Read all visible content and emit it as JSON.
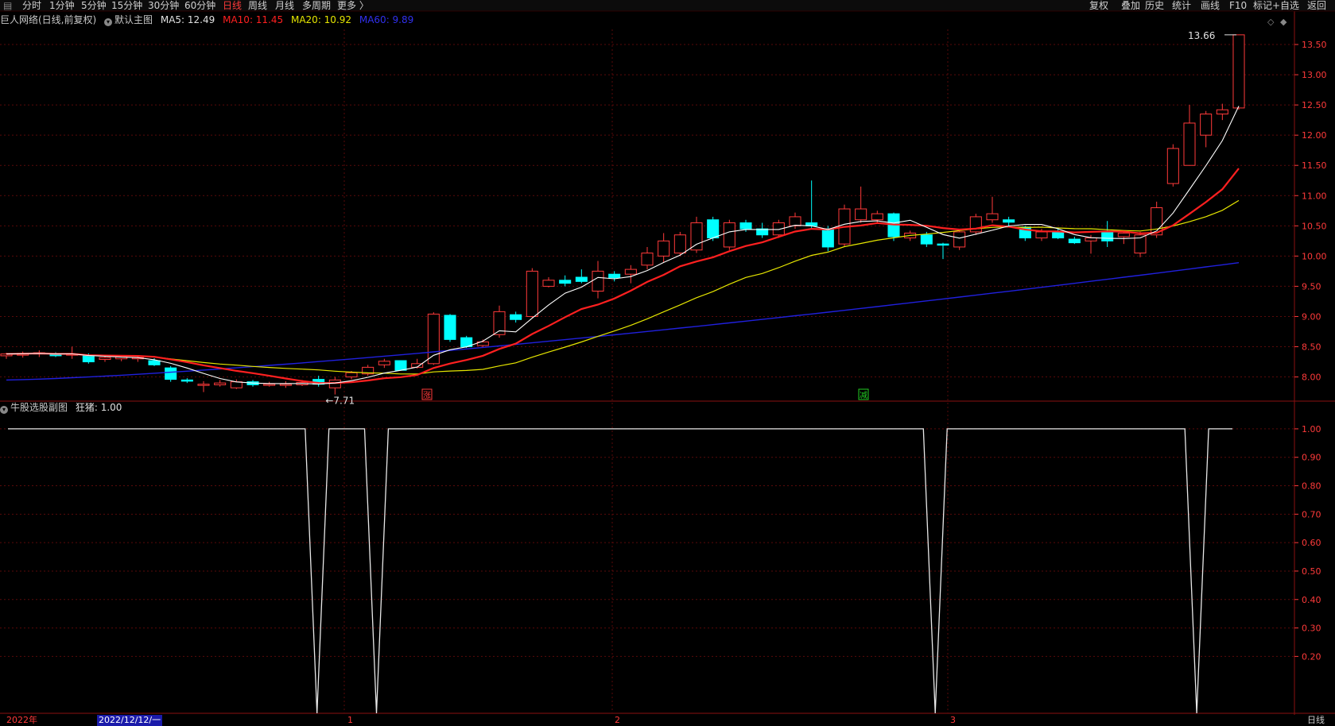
{
  "toolbar": {
    "left_items": [
      {
        "label": "分时",
        "active": false
      },
      {
        "label": "1分钟",
        "active": false
      },
      {
        "label": "5分钟",
        "active": false
      },
      {
        "label": "15分钟",
        "active": false
      },
      {
        "label": "30分钟",
        "active": false
      },
      {
        "label": "60分钟",
        "active": false
      },
      {
        "label": "日线",
        "active": true
      },
      {
        "label": "周线",
        "active": false
      },
      {
        "label": "月线",
        "active": false
      },
      {
        "label": "多周期",
        "active": false
      },
      {
        "label": "更多 〉",
        "active": false
      }
    ],
    "right_items": [
      "复权",
      "叠加",
      "历史",
      "统计",
      "画线",
      "F10",
      "标记",
      "+自选",
      "返回"
    ]
  },
  "main_header": {
    "stock": "巨人网络(日线,前复权)",
    "indicator": "默认主图",
    "ma5": "MA5: 12.49",
    "ma10": "MA10: 11.45",
    "ma20": "MA20: 10.92",
    "ma60": "MA60: 9.89"
  },
  "sub_header": {
    "indicator": "牛股选股副图",
    "value": "狂猪: 1.00"
  },
  "annotations": {
    "high": "13.66",
    "low": "←7.71",
    "rise_mark": "涨",
    "fall_mark": "减"
  },
  "statusbar": {
    "year": "2022年",
    "cursor_date": "2022/12/12/一",
    "months": [
      "1",
      "2",
      "3"
    ],
    "period": "日线"
  },
  "colors": {
    "background": "#000000",
    "grid": "#5a0a0a",
    "up": "#ff3a3a",
    "down": "#00ffff",
    "ma5": "#ffffff",
    "ma10": "#ff2020",
    "ma20": "#e6e600",
    "ma60": "#2020dd",
    "axis_text": "#ff3a3a"
  },
  "chart_data": [
    {
      "type": "candlestick",
      "title": "巨人网络(日线,前复权)",
      "ylim": [
        7.6,
        13.75
      ],
      "y_ticks": [
        "13.50",
        "13.00",
        "12.50",
        "12.00",
        "11.50",
        "11.00",
        "10.50",
        "10.00",
        "9.50",
        "9.00",
        "8.50",
        "8.00"
      ],
      "ohlc": [
        [
          8.35,
          8.4,
          8.3,
          8.38
        ],
        [
          8.36,
          8.42,
          8.32,
          8.39
        ],
        [
          8.38,
          8.44,
          8.33,
          8.4
        ],
        [
          8.37,
          8.41,
          8.33,
          8.36
        ],
        [
          8.36,
          8.5,
          8.3,
          8.38
        ],
        [
          8.35,
          8.39,
          8.22,
          8.25
        ],
        [
          8.29,
          8.34,
          8.25,
          8.32
        ],
        [
          8.3,
          8.36,
          8.26,
          8.33
        ],
        [
          8.3,
          8.36,
          8.25,
          8.32
        ],
        [
          8.27,
          8.31,
          8.18,
          8.2
        ],
        [
          8.15,
          8.18,
          7.92,
          7.96
        ],
        [
          7.95,
          7.98,
          7.9,
          7.93
        ],
        [
          7.88,
          7.93,
          7.75,
          7.88
        ],
        [
          7.87,
          7.95,
          7.84,
          7.9
        ],
        [
          7.82,
          7.96,
          7.8,
          7.92
        ],
        [
          7.92,
          7.95,
          7.84,
          7.87
        ],
        [
          7.88,
          7.92,
          7.84,
          7.88
        ],
        [
          7.86,
          7.93,
          7.82,
          7.88
        ],
        [
          7.87,
          7.95,
          7.85,
          7.91
        ],
        [
          7.96,
          8.02,
          7.84,
          7.88
        ],
        [
          7.82,
          8.0,
          7.71,
          7.95
        ],
        [
          8.0,
          8.1,
          7.96,
          8.07
        ],
        [
          8.05,
          8.2,
          8.02,
          8.16
        ],
        [
          8.2,
          8.3,
          8.15,
          8.26
        ],
        [
          8.27,
          8.19,
          8.12,
          8.11
        ],
        [
          8.16,
          8.3,
          8.14,
          8.22
        ],
        [
          8.22,
          9.07,
          8.2,
          9.04
        ],
        [
          9.02,
          9.04,
          8.58,
          8.62
        ],
        [
          8.65,
          8.68,
          8.48,
          8.5
        ],
        [
          8.52,
          8.62,
          8.48,
          8.58
        ],
        [
          8.7,
          9.18,
          8.65,
          9.08
        ],
        [
          9.03,
          9.08,
          8.9,
          8.95
        ],
        [
          9.0,
          9.8,
          8.98,
          9.75
        ],
        [
          9.5,
          9.65,
          9.48,
          9.6
        ],
        [
          9.6,
          9.68,
          9.5,
          9.55
        ],
        [
          9.65,
          9.78,
          9.55,
          9.58
        ],
        [
          9.42,
          9.92,
          9.3,
          9.75
        ],
        [
          9.7,
          9.75,
          9.58,
          9.64
        ],
        [
          9.7,
          9.85,
          9.55,
          9.78
        ],
        [
          9.85,
          10.15,
          9.78,
          10.05
        ],
        [
          10.0,
          10.38,
          9.9,
          10.25
        ],
        [
          10.05,
          10.4,
          10.0,
          10.35
        ],
        [
          10.1,
          10.65,
          10.05,
          10.55
        ],
        [
          10.6,
          10.65,
          10.25,
          10.3
        ],
        [
          10.15,
          10.6,
          10.1,
          10.55
        ],
        [
          10.55,
          10.6,
          10.4,
          10.45
        ],
        [
          10.45,
          10.55,
          10.3,
          10.35
        ],
        [
          10.35,
          10.6,
          10.3,
          10.55
        ],
        [
          10.5,
          10.72,
          10.45,
          10.65
        ],
        [
          10.55,
          11.25,
          10.45,
          10.5
        ],
        [
          10.45,
          10.5,
          10.08,
          10.15
        ],
        [
          10.2,
          10.85,
          10.15,
          10.78
        ],
        [
          10.6,
          11.15,
          10.55,
          10.78
        ],
        [
          10.6,
          10.75,
          10.55,
          10.7
        ],
        [
          10.7,
          10.72,
          10.25,
          10.32
        ],
        [
          10.3,
          10.42,
          10.25,
          10.38
        ],
        [
          10.35,
          10.4,
          10.15,
          10.2
        ],
        [
          10.2,
          10.22,
          9.95,
          10.18
        ],
        [
          10.15,
          10.45,
          10.1,
          10.4
        ],
        [
          10.4,
          10.7,
          10.35,
          10.65
        ],
        [
          10.6,
          10.98,
          10.55,
          10.7
        ],
        [
          10.6,
          10.65,
          10.48,
          10.56
        ],
        [
          10.48,
          10.5,
          10.25,
          10.3
        ],
        [
          10.3,
          10.45,
          10.25,
          10.4
        ],
        [
          10.4,
          10.45,
          10.28,
          10.3
        ],
        [
          10.28,
          10.32,
          10.2,
          10.22
        ],
        [
          10.25,
          10.35,
          10.04,
          10.3
        ],
        [
          10.4,
          10.58,
          10.15,
          10.25
        ],
        [
          10.32,
          10.42,
          10.2,
          10.38
        ],
        [
          10.05,
          10.4,
          9.98,
          10.35
        ],
        [
          10.35,
          10.9,
          10.3,
          10.8
        ],
        [
          11.2,
          11.85,
          11.15,
          11.78
        ],
        [
          11.5,
          12.5,
          11.5,
          12.2
        ],
        [
          12.0,
          12.4,
          11.8,
          12.35
        ],
        [
          12.35,
          12.52,
          12.25,
          12.42
        ],
        [
          12.45,
          13.66,
          12.42,
          13.66
        ]
      ],
      "ma5_label": "MA5",
      "ma10_label": "MA10",
      "ma20_label": "MA20",
      "ma60_label": "MA60",
      "ma60_start": 7.95,
      "ma60_end": 9.89
    },
    {
      "type": "line",
      "title": "牛股选股副图",
      "series": [
        {
          "name": "狂猪",
          "values": [
            1,
            1,
            1,
            1,
            1,
            1,
            1,
            1,
            1,
            1,
            1,
            1,
            1,
            1,
            1,
            1,
            1,
            1,
            1,
            1,
            1,
            1,
            1,
            1,
            1,
            1,
            0,
            1,
            1,
            1,
            1,
            0,
            1,
            1,
            1,
            1,
            1,
            1,
            1,
            1,
            1,
            1,
            1,
            1,
            1,
            1,
            1,
            1,
            1,
            1,
            1,
            1,
            1,
            1,
            1,
            1,
            1,
            1,
            1,
            1,
            1,
            1,
            1,
            1,
            1,
            1,
            1,
            1,
            1,
            1,
            1,
            1,
            1,
            1,
            1,
            1,
            1,
            1,
            0,
            1,
            1,
            1,
            1,
            1,
            1,
            1,
            1,
            1,
            1,
            1,
            1,
            1,
            1,
            1,
            1,
            1,
            1,
            1,
            1,
            1,
            0,
            1,
            1,
            1
          ]
        }
      ],
      "ylim": [
        0.0,
        1.05
      ],
      "y_ticks": [
        "1.00",
        "0.90",
        "0.80",
        "0.70",
        "0.60",
        "0.50",
        "0.40",
        "0.30",
        "0.20"
      ]
    }
  ]
}
